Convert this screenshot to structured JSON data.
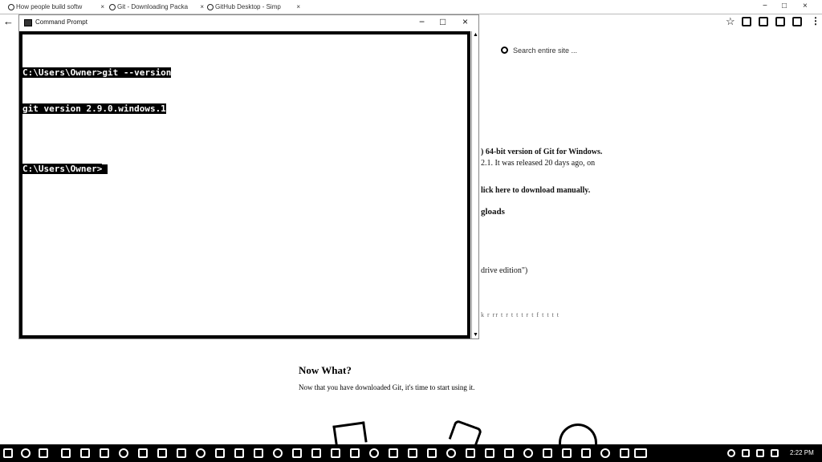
{
  "browser": {
    "tabs": [
      {
        "label": "How people build softw"
      },
      {
        "label": "Git - Downloading Packa"
      },
      {
        "label": "GitHub Desktop - Simp"
      }
    ],
    "controls": {
      "minimize": "−",
      "maximize": "□",
      "close": "×"
    }
  },
  "toolbar": {
    "back_label": "←",
    "star_label": "☆",
    "menu_label": "⋮"
  },
  "page": {
    "search_placeholder": "Search entire site ...",
    "lines": [
      ") 64-bit version of Git for Windows.",
      "2.1. It was released 20 days ago, on",
      "lick here to download manually.",
      "gloads",
      "drive edition\")",
      "k r rr t r t t t r t f t t t t"
    ],
    "now_what_title": "Now What?",
    "now_what_desc": "Now that you have downloaded Git, it's time to start using it."
  },
  "cmd": {
    "title": "Command Prompt",
    "min": "−",
    "max": "□",
    "close": "×",
    "lines": [
      "C:\\Users\\Owner>git --version",
      "git version 2.9.0.windows.1",
      "",
      "C:\\Users\\Owner>"
    ]
  },
  "taskbar": {
    "clock": "2:22 PM"
  }
}
